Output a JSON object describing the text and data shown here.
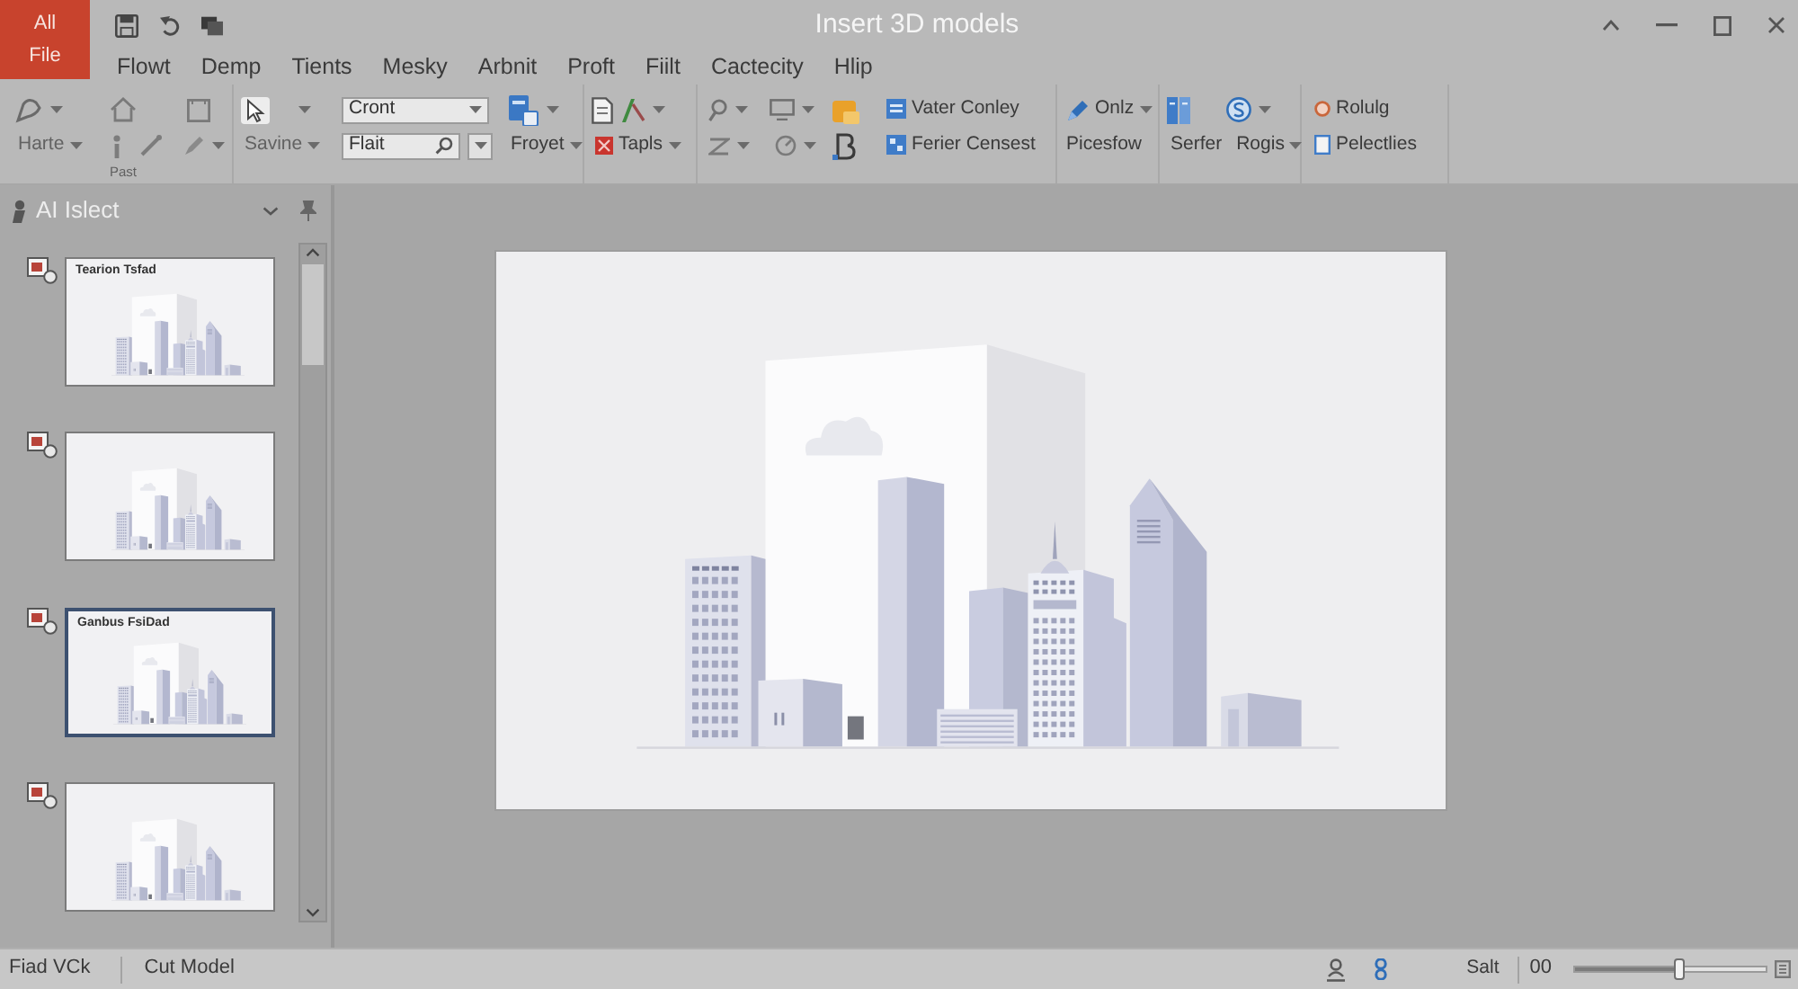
{
  "app_button": {
    "line_1": "All",
    "line_2": "File"
  },
  "window": {
    "title": "Insert 3D models"
  },
  "menu": [
    "Flowt",
    "Demp",
    "Tients",
    "Mesky",
    "Arbnit",
    "Proft",
    "Fiilt",
    "Cactecity",
    "Hlip"
  ],
  "ribbon": {
    "edit": {
      "button": "Harte",
      "group_label": "Past"
    },
    "select": {
      "button": "Savine"
    },
    "font": {
      "font_field": {
        "value": "Cront"
      },
      "search_field": {
        "value": "Flait"
      }
    },
    "project": {
      "button": "Froyet"
    },
    "tools": {
      "button": "Tapls"
    },
    "views": {
      "top": "Vater Conley",
      "bottom": "Ferier Censest"
    },
    "draw": {
      "top": "Onlz",
      "bottom": "Picesfow"
    },
    "server": {
      "left": "Serfer",
      "right": "Rogis"
    },
    "rules": {
      "top": "Rolulg",
      "bottom": "Pelectlies"
    }
  },
  "panel": {
    "title": "AI Islect",
    "slides": [
      {
        "title": "Tearion Tsfad",
        "selected": false
      },
      {
        "selected": false
      },
      {
        "title": "Ganbus FsiDad",
        "selected": true
      },
      {
        "selected": false
      }
    ]
  },
  "status_bar": {
    "left": [
      "Fiad VCk",
      "Cut Model"
    ],
    "view": "Salt",
    "zoom": "00",
    "zoom_slider": {
      "level": 0.55
    }
  }
}
